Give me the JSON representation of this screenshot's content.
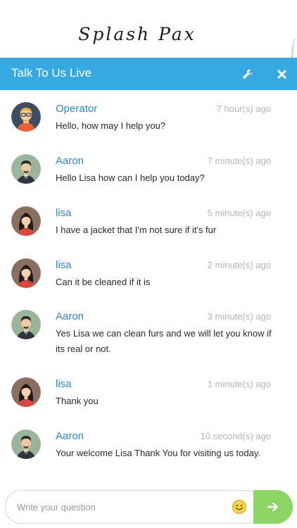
{
  "brand": {
    "logo_text": "Splash Pax"
  },
  "header": {
    "title": "Talk To Us Live",
    "settings_icon": "wrench-icon",
    "close_icon": "close-icon",
    "accent_color": "#38a8e0"
  },
  "messages": [
    {
      "sender": "Operator",
      "avatar": "operator",
      "time": "7 hour(s) ago",
      "text": "Hello, how may I help you?"
    },
    {
      "sender": "Aaron",
      "avatar": "man",
      "time": "7 minute(s) ago",
      "text": "Hello Lisa how can I help you today?"
    },
    {
      "sender": "lisa",
      "avatar": "woman",
      "time": "5 minute(s) ago",
      "text": "I have a jacket that I'm not sure if it's fur"
    },
    {
      "sender": "lisa",
      "avatar": "woman",
      "time": "2 minute(s) ago",
      "text": "Can it be cleaned if it is"
    },
    {
      "sender": "Aaron",
      "avatar": "man",
      "time": "3 minute(s) ago",
      "text": "Yes Lisa we can clean furs and we will let you know if its real or not."
    },
    {
      "sender": "lisa",
      "avatar": "woman",
      "time": "1 minute(s) ago",
      "text": "Thank you"
    },
    {
      "sender": "Aaron",
      "avatar": "man",
      "time": "10 second(s) ago",
      "text": "Your welcome Lisa Thank You for visiting us today."
    }
  ],
  "composer": {
    "input_value": "",
    "placeholder": "Write your question",
    "emoji_icon": "smiley-emoji-icon",
    "send_icon": "arrow-right-icon",
    "send_color": "#8cd466"
  }
}
